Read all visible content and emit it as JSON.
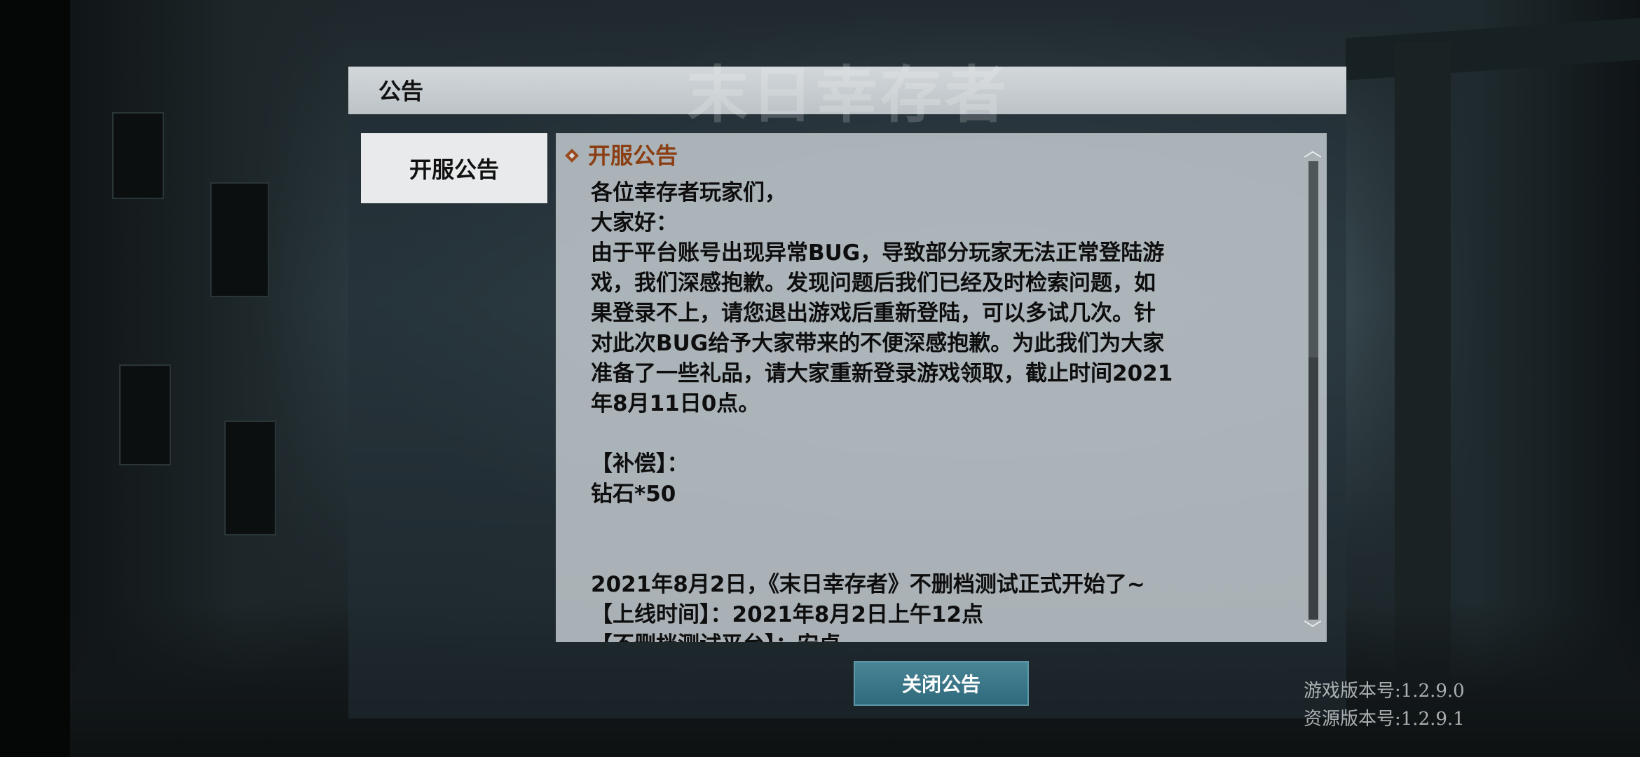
{
  "dialog": {
    "title": "公告",
    "logo_watermark": "末日幸存者",
    "tabs": [
      {
        "label": "开服公告"
      }
    ],
    "section_title": "开服公告",
    "body": {
      "greeting": "各位幸存者玩家们，",
      "hello": "大家好：",
      "paragraph_lines": [
        "由于平台账号出现异常BUG，导致部分玩家无法正常登陆游",
        "戏，我们深感抱歉。发现问题后我们已经及时检索问题，如",
        "果登录不上，请您退出游戏后重新登陆，可以多试几次。针",
        "对此次BUG给予大家带来的不便深感抱歉。为此我们为大家",
        "准备了一些礼品，请大家重新登录游戏领取，截止时间2021",
        "年8月11日0点。"
      ],
      "compensation_label": "【补偿】：",
      "compensation_item": "钻石*50",
      "launch_line": "2021年8月2日，《末日幸存者》不删档测试正式开始了~",
      "online_time_line": "【上线时间】：2021年8月2日上午12点",
      "partial_line": "【不删档测试平台】：安卓"
    },
    "close_button_label": "关闭公告"
  },
  "version": {
    "game": "游戏版本号:1.2.9.0",
    "resource": "资源版本号:1.2.9.1"
  },
  "colors": {
    "accent_heading": "#8a3e12",
    "close_button": "#3a7789"
  }
}
